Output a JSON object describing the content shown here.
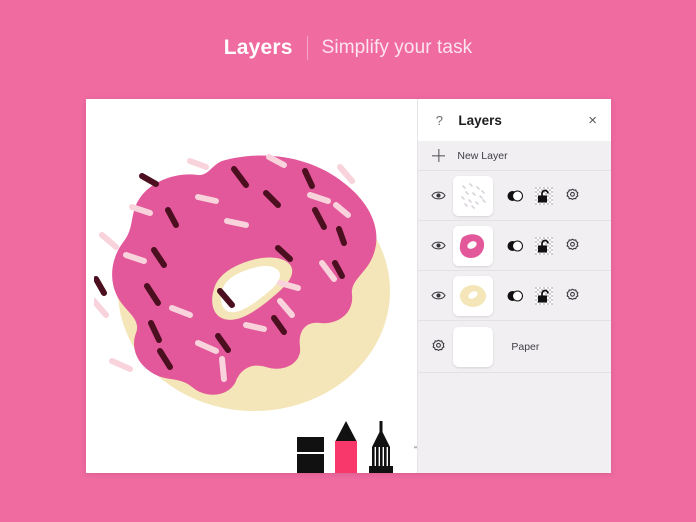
{
  "banner": {
    "title": "Layers",
    "subtitle": "Simplify your task"
  },
  "colors": {
    "background_pink": "#ef6ba0",
    "frosting_pink": "#e2589a",
    "dough_cream": "#f4e6b9",
    "sprinkle_dark": "#4b0f20",
    "sprinkle_light": "#f9d3dc",
    "panel_gray": "#f1eff2",
    "marker_pink": "#f8376b",
    "tool_black": "#111111"
  },
  "panel": {
    "help_icon": "help-question-icon",
    "help_label": "?",
    "title": "Layers",
    "close_label": "×",
    "new_layer": {
      "icon": "plus-icon",
      "label": "New Layer"
    },
    "layers": [
      {
        "name": "sprinkles-layer",
        "visibility_icon": "eye-icon",
        "thumbnail": "sprinkles-thumbnail",
        "blend_icon": "blend-mode-icon",
        "lock_icon": "unlocked-padlock-icon",
        "settings_icon": "gear-icon"
      },
      {
        "name": "frosting-layer",
        "visibility_icon": "eye-icon",
        "thumbnail": "frosting-thumbnail",
        "blend_icon": "blend-mode-icon",
        "lock_icon": "unlocked-padlock-icon",
        "settings_icon": "gear-icon"
      },
      {
        "name": "dough-layer",
        "visibility_icon": "eye-icon",
        "thumbnail": "dough-thumbnail",
        "blend_icon": "blend-mode-icon",
        "lock_icon": "unlocked-padlock-icon",
        "settings_icon": "gear-icon"
      }
    ],
    "paper": {
      "settings_icon": "gear-icon",
      "thumbnail": "paper-thumbnail",
      "label": "Paper"
    }
  },
  "canvas": {
    "artwork_name": "pink-frosted-donut-illustration",
    "tools": [
      {
        "name": "eraser-tool",
        "icon": "eraser-icon"
      },
      {
        "name": "marker-tool",
        "icon": "marker-icon"
      },
      {
        "name": "pen-tool",
        "icon": "pen-icon"
      }
    ],
    "add_tool": {
      "name": "add-tool-button",
      "icon": "plus-icon"
    }
  }
}
